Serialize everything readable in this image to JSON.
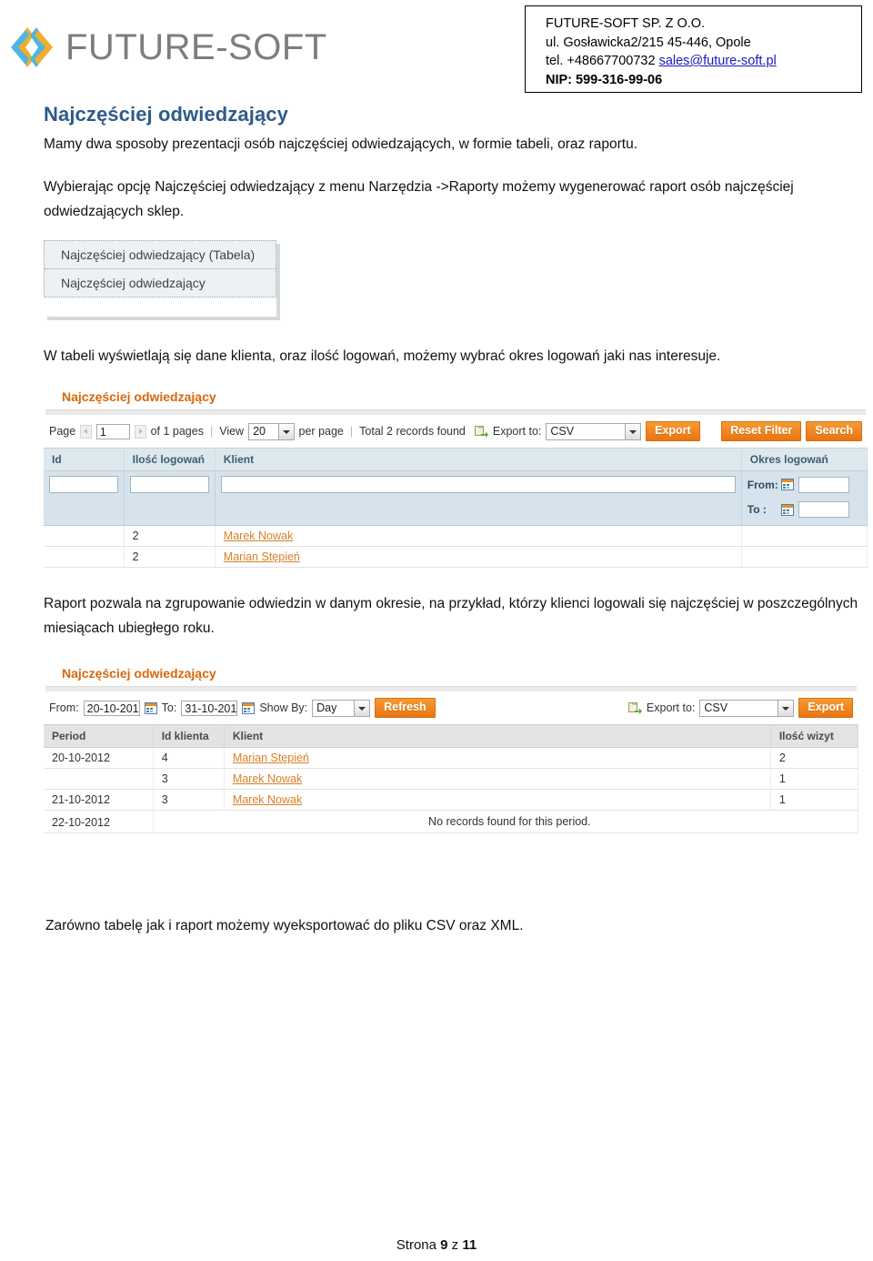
{
  "header": {
    "logo_text": "FUTURE-SOFT",
    "logo_icon": "chevron-diamond-logo",
    "contact": {
      "company": "FUTURE-SOFT SP. Z O.O.",
      "address": "ul. Gosławicka2/215 45-446, Opole",
      "phone_label": "tel. +48667700732",
      "email": "sales@future-soft.pl",
      "nip": "NIP: 599-316-99-06"
    }
  },
  "document": {
    "title": "Najczęściej odwiedzający",
    "paragraph_1": "Mamy dwa sposoby prezentacji osób najczęściej odwiedzających, w formie tabeli, oraz raportu.",
    "paragraph_2": "Wybierając opcję Najczęściej odwiedzający z menu Narzędzia ->Raporty możemy wygenerować raport osób najczęściej odwiedzających sklep.",
    "paragraph_3": "W tabeli wyświetlają się dane klienta, oraz ilość logowań, możemy wybrać okres logowań jaki nas interesuje.",
    "paragraph_4": "Raport pozwala na zgrupowanie odwiedzin w danym okresie, na przykład, którzy klienci logowali się najczęściej w poszczególnych miesiącach ubiegłego roku.",
    "paragraph_5": "Zarówno tabelę jak i raport możemy wyeksportować do pliku CSV oraz XML."
  },
  "menu_screenshot": {
    "items": [
      "Najczęściej odwiedzający (Tabela)",
      "Najczęściej odwiedzający"
    ]
  },
  "table_screenshot": {
    "title": "Najczęściej odwiedzający",
    "toolbar": {
      "page_label": "Page",
      "page_value": "1",
      "of_pages": "of 1 pages",
      "view_label": "View",
      "view_value": "20",
      "per_page": "per page",
      "total": "Total 2 records found",
      "export_icon": "export-icon",
      "export_to_label": "Export to:",
      "export_format": "CSV",
      "export_button": "Export",
      "reset_filter_button": "Reset Filter",
      "search_button": "Search",
      "prev_arrow_icon": "arrow-left-icon",
      "next_arrow_icon": "arrow-right-icon"
    },
    "columns": [
      "Id",
      "Ilość logowań",
      "Klient",
      "Okres logowań"
    ],
    "filter": {
      "from_label": "From:",
      "to_label": "To :",
      "calendar_icon": "calendar-icon",
      "id_value": "",
      "count_value": "",
      "client_value": "",
      "from_value": "",
      "to_value": ""
    },
    "rows": [
      {
        "id": "",
        "count": "2",
        "client": "Marek Nowak",
        "period": ""
      },
      {
        "id": "",
        "count": "2",
        "client": "Marian Stępień",
        "period": ""
      }
    ]
  },
  "report_screenshot": {
    "title": "Najczęściej odwiedzający",
    "toolbar": {
      "from_label": "From:",
      "from_value": "20-10-201:",
      "to_label": "To:",
      "to_value": "31-10-201:",
      "calendar_icon": "calendar-icon",
      "show_by_label": "Show By:",
      "show_by_value": "Day",
      "refresh_button": "Refresh",
      "export_icon": "export-icon",
      "export_to_label": "Export to:",
      "export_format": "CSV",
      "export_button": "Export"
    },
    "columns": [
      "Period",
      "Id klienta",
      "Klient",
      "Ilość wizyt"
    ],
    "rows": [
      {
        "period": "20-10-2012",
        "client_id": "4",
        "client": "Marian Stępień",
        "visits": "2"
      },
      {
        "period": "",
        "client_id": "3",
        "client": "Marek Nowak",
        "visits": "1"
      },
      {
        "period": "21-10-2012",
        "client_id": "3",
        "client": "Marek Nowak",
        "visits": "1"
      }
    ],
    "empty_period": "22-10-2012",
    "empty_message": "No records found for this period."
  },
  "footer": {
    "prefix": "Strona ",
    "page": "9",
    "middle": " z ",
    "total": "11"
  },
  "colors": {
    "heading_blue": "#2e5b8a",
    "accent_orange": "#ea7411",
    "link_orange": "#d98026",
    "link_blue": "#1a1ab5",
    "grid_header": "#e3e3e3",
    "filter_blue": "#d6e3ec"
  }
}
